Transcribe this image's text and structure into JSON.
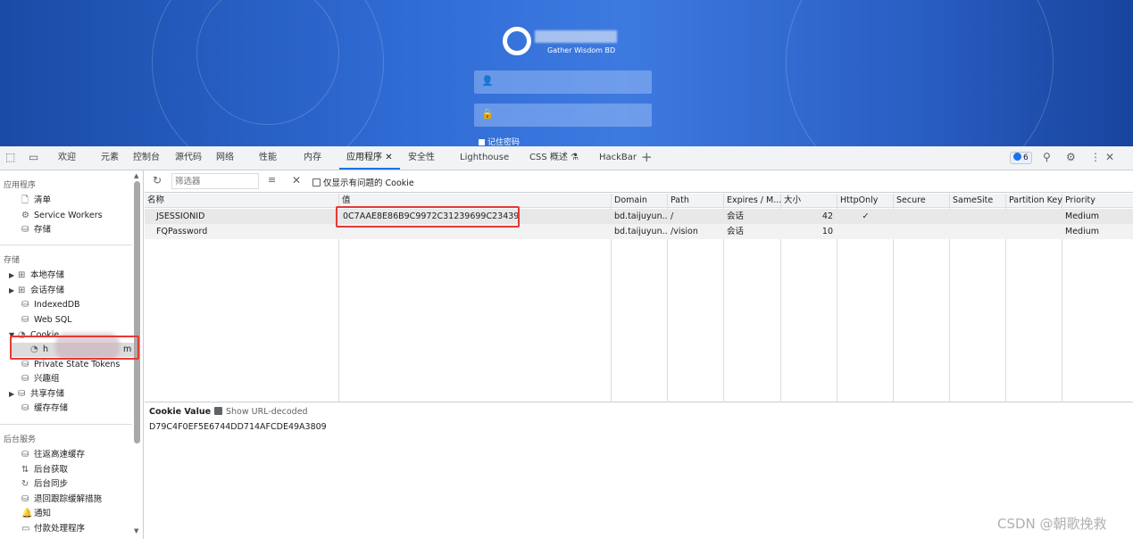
{
  "page": {
    "logo_subtitle": "Gather Wisdom BD",
    "remember_label": "记住密码",
    "username_icon": "user-icon",
    "password_icon": "lock-icon"
  },
  "devtools": {
    "tabs": [
      "欢迎",
      "元素",
      "控制台",
      "源代码",
      "网络",
      "性能",
      "内存",
      "应用程序",
      "安全性",
      "Lighthouse",
      "CSS 概述",
      "HackBar"
    ],
    "active_tab": "应用程序",
    "issues_count": "6"
  },
  "sidebar": {
    "app_section": "应用程序",
    "app_items": [
      "清单",
      "Service Workers",
      "存储"
    ],
    "storage_section": "存储",
    "storage_items": [
      "本地存储",
      "会话存储",
      "IndexedDB",
      "Web SQL",
      "Cookie",
      "Private State Tokens",
      "兴趣组",
      "共享存储",
      "缓存存储"
    ],
    "cookie_child": "h",
    "cookie_child_tail": "m",
    "bg_section": "后台服务",
    "bg_items": [
      "往返高速缓存",
      "后台获取",
      "后台同步",
      "退回跟踪缓解措施",
      "通知",
      "付款处理程序"
    ]
  },
  "toolbar": {
    "filter_placeholder": "筛选器",
    "only_issues_label": "仅显示有问题的 Cookie"
  },
  "table": {
    "columns": [
      "名称",
      "值",
      "Domain",
      "Path",
      "Expires / M...",
      "大小",
      "HttpOnly",
      "Secure",
      "SameSite",
      "Partition Key",
      "Priority"
    ],
    "rows": [
      {
        "name": "JSESSIONID",
        "value": "0C7AAE8E86B9C9972C31239699C23439",
        "domain": "bd.taijuyun...",
        "path": "/",
        "expires": "会话",
        "size": "42",
        "httponly": "✓",
        "secure": "",
        "samesite": "",
        "partition": "",
        "priority": "Medium"
      },
      {
        "name": "FQPassword",
        "value": "",
        "domain": "bd.taijuyun...",
        "path": "/vision",
        "expires": "会话",
        "size": "10",
        "httponly": "",
        "secure": "",
        "samesite": "",
        "partition": "",
        "priority": "Medium"
      }
    ]
  },
  "detail": {
    "label": "Cookie Value",
    "decode_label": "Show URL-decoded",
    "value": "D79C4F0EF5E6744DD714AFCDE49A3809"
  },
  "watermark": "CSDN @朝歌挽救",
  "colors": {
    "accent": "#1a73e8",
    "highlight": "#e53935",
    "page_bg": "#2f6bd4"
  }
}
